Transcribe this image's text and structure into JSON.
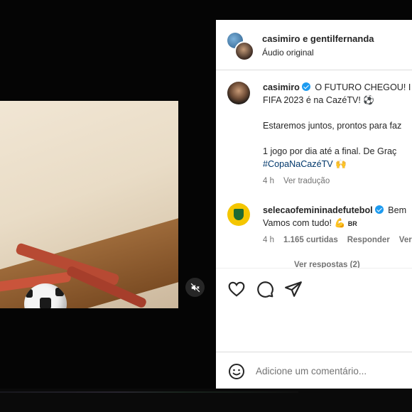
{
  "post": {
    "header": {
      "usernames": "casimiro e gentilfernanda",
      "audio": "Áudio original"
    },
    "caption": {
      "username": "casimiro",
      "line1": "O FUTURO CHEGOU! I",
      "line2": "FIFA 2023 é na CazéTV! ⚽",
      "line3": "Estaremos juntos, prontos para faz",
      "line4": "1 jogo por dia até a final. De Graç",
      "hashtag": "#CopaNaCazéTV",
      "emoji": "🙌",
      "time": "4 h",
      "translate": "Ver tradução"
    },
    "comment": {
      "username": "selecaofemininadefutebol",
      "text_tail": "Bem",
      "line2": "Vamos com tudo! 💪",
      "flag": "BR",
      "time": "4 h",
      "likes": "1.165 curtidas",
      "reply": "Responder",
      "translate": "Ver t",
      "view_replies": "Ver respostas (2)"
    },
    "add_comment": {
      "placeholder": "Adicione um comentário..."
    }
  },
  "icons": {
    "mute": "speaker-muted-icon",
    "like": "heart-icon",
    "comment": "comment-bubble-icon",
    "share": "paper-plane-icon",
    "emoji": "smiley-icon",
    "verified": "verified-badge-icon"
  },
  "colors": {
    "link": "#00376b",
    "verified": "#1d9bf0",
    "muted_text": "#737373",
    "text": "#262626"
  }
}
